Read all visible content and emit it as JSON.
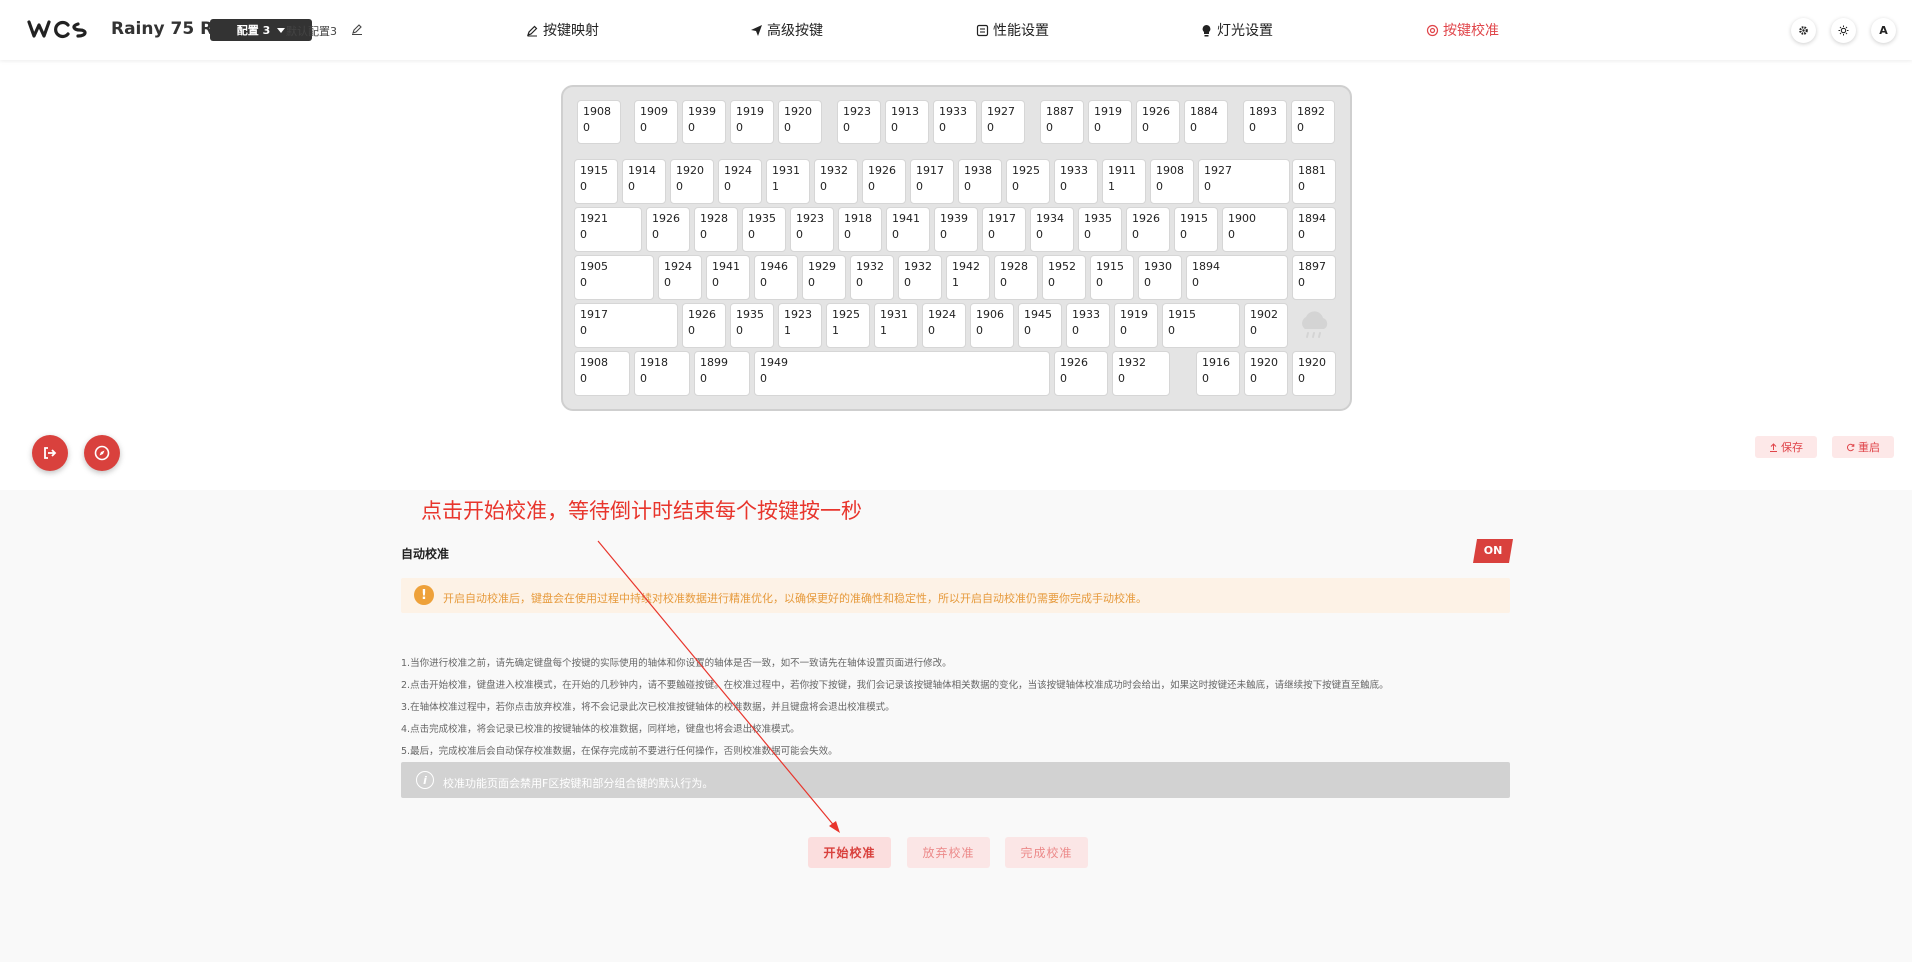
{
  "header": {
    "title": "Rainy 75 RT",
    "profile_dropdown": "配置 3",
    "profile_name": "默认配置3",
    "tabs": [
      {
        "label": "按键映射",
        "icon": "pencil-icon",
        "active": false
      },
      {
        "label": "高级按键",
        "icon": "paper-plane-icon",
        "active": false
      },
      {
        "label": "性能设置",
        "icon": "gauge-icon",
        "active": false
      },
      {
        "label": "灯光设置",
        "icon": "bulb-icon",
        "active": false
      },
      {
        "label": "按键校准",
        "icon": "target-icon",
        "active": true
      }
    ],
    "right_buttons": [
      "gear-icon",
      "sun-icon",
      "A"
    ]
  },
  "keyboard": {
    "rows": [
      [
        {
          "top": "1908",
          "bottom": "0"
        },
        {
          "top": "1909",
          "bottom": "0"
        },
        {
          "top": "1939",
          "bottom": "0"
        },
        {
          "top": "1919",
          "bottom": "0"
        },
        {
          "top": "1920",
          "bottom": "0"
        },
        {
          "top": "1923",
          "bottom": "0"
        },
        {
          "top": "1913",
          "bottom": "0"
        },
        {
          "top": "1933",
          "bottom": "0"
        },
        {
          "top": "1927",
          "bottom": "0"
        },
        {
          "top": "1887",
          "bottom": "0"
        },
        {
          "top": "1919",
          "bottom": "0"
        },
        {
          "top": "1926",
          "bottom": "0"
        },
        {
          "top": "1884",
          "bottom": "0"
        },
        {
          "top": "1893",
          "bottom": "0"
        },
        {
          "top": "1892",
          "bottom": "0"
        }
      ],
      [
        {
          "top": "1915",
          "bottom": "0"
        },
        {
          "top": "1914",
          "bottom": "0"
        },
        {
          "top": "1920",
          "bottom": "0"
        },
        {
          "top": "1924",
          "bottom": "0"
        },
        {
          "top": "1931",
          "bottom": "1"
        },
        {
          "top": "1932",
          "bottom": "0"
        },
        {
          "top": "1926",
          "bottom": "0"
        },
        {
          "top": "1917",
          "bottom": "0"
        },
        {
          "top": "1938",
          "bottom": "0"
        },
        {
          "top": "1925",
          "bottom": "0"
        },
        {
          "top": "1933",
          "bottom": "0"
        },
        {
          "top": "1911",
          "bottom": "1"
        },
        {
          "top": "1908",
          "bottom": "0"
        },
        {
          "top": "1927",
          "bottom": "0"
        },
        {
          "top": "1881",
          "bottom": "0"
        }
      ],
      [
        {
          "top": "1921",
          "bottom": "0"
        },
        {
          "top": "1926",
          "bottom": "0"
        },
        {
          "top": "1928",
          "bottom": "0"
        },
        {
          "top": "1935",
          "bottom": "0"
        },
        {
          "top": "1923",
          "bottom": "0"
        },
        {
          "top": "1918",
          "bottom": "0"
        },
        {
          "top": "1941",
          "bottom": "0"
        },
        {
          "top": "1939",
          "bottom": "0"
        },
        {
          "top": "1917",
          "bottom": "0"
        },
        {
          "top": "1934",
          "bottom": "0"
        },
        {
          "top": "1935",
          "bottom": "0"
        },
        {
          "top": "1926",
          "bottom": "0"
        },
        {
          "top": "1915",
          "bottom": "0"
        },
        {
          "top": "1900",
          "bottom": "0"
        },
        {
          "top": "1894",
          "bottom": "0"
        }
      ],
      [
        {
          "top": "1905",
          "bottom": "0"
        },
        {
          "top": "1924",
          "bottom": "0"
        },
        {
          "top": "1941",
          "bottom": "0"
        },
        {
          "top": "1946",
          "bottom": "0"
        },
        {
          "top": "1929",
          "bottom": "0"
        },
        {
          "top": "1932",
          "bottom": "0"
        },
        {
          "top": "1932",
          "bottom": "0"
        },
        {
          "top": "1942",
          "bottom": "1"
        },
        {
          "top": "1928",
          "bottom": "0"
        },
        {
          "top": "1952",
          "bottom": "0"
        },
        {
          "top": "1915",
          "bottom": "0"
        },
        {
          "top": "1930",
          "bottom": "0"
        },
        {
          "top": "1894",
          "bottom": "0"
        },
        {
          "top": "1897",
          "bottom": "0"
        }
      ],
      [
        {
          "top": "1917",
          "bottom": "0"
        },
        {
          "top": "1926",
          "bottom": "0"
        },
        {
          "top": "1935",
          "bottom": "0"
        },
        {
          "top": "1923",
          "bottom": "1"
        },
        {
          "top": "1925",
          "bottom": "1"
        },
        {
          "top": "1931",
          "bottom": "1"
        },
        {
          "top": "1924",
          "bottom": "0"
        },
        {
          "top": "1906",
          "bottom": "0"
        },
        {
          "top": "1945",
          "bottom": "0"
        },
        {
          "top": "1933",
          "bottom": "0"
        },
        {
          "top": "1919",
          "bottom": "0"
        },
        {
          "top": "1915",
          "bottom": "0"
        },
        {
          "top": "1902",
          "bottom": "0"
        }
      ],
      [
        {
          "top": "1908",
          "bottom": "0"
        },
        {
          "top": "1918",
          "bottom": "0"
        },
        {
          "top": "1899",
          "bottom": "0"
        },
        {
          "top": "1949",
          "bottom": "0"
        },
        {
          "top": "1926",
          "bottom": "0"
        },
        {
          "top": "1932",
          "bottom": "0"
        },
        {
          "top": "1916",
          "bottom": "0"
        },
        {
          "top": "1920",
          "bottom": "0"
        },
        {
          "top": "1920",
          "bottom": "0"
        }
      ]
    ]
  },
  "actions": {
    "save": "保存",
    "restart": "重启"
  },
  "annotation": "点击开始校准，等待倒计时结束每个按键按一秒",
  "calibration": {
    "auto_label": "自动校准",
    "toggle": "ON",
    "warning": "开启自动校准后，键盘会在使用过程中持续对校准数据进行精准优化，以确保更好的准确性和稳定性，所以开启自动校准仍需要你完成手动校准。",
    "instructions": [
      "1.当你进行校准之前，请先确定键盘每个按键的实际使用的轴体和你设置的轴体是否一致，如不一致请先在轴体设置页面进行修改。",
      "2.点击开始校准，键盘进入校准模式，在开始的几秒钟内，请不要触碰按键。在校准过程中，若你按下按键，我们会记录该按键轴体相关数据的变化，当该按键轴体校准成功时会给出，如果这时按键还未触底，请继续按下按键直至触底。",
      "3.在轴体校准过程中，若你点击放弃校准，将不会记录此次已校准按键轴体的校准数据，并且键盘将会退出校准模式。",
      "4.点击完成校准，将会记录已校准的按键轴体的校准数据，同样地，键盘也将会退出校准模式。",
      "5.最后，完成校准后会自动保存校准数据，在保存完成前不要进行任何操作，否则校准数据可能会失效。"
    ],
    "info": "校准功能页面会禁用F区按键和部分组合键的默认行为。",
    "buttons": [
      "开始校准",
      "放弃校准",
      "完成校准"
    ]
  }
}
